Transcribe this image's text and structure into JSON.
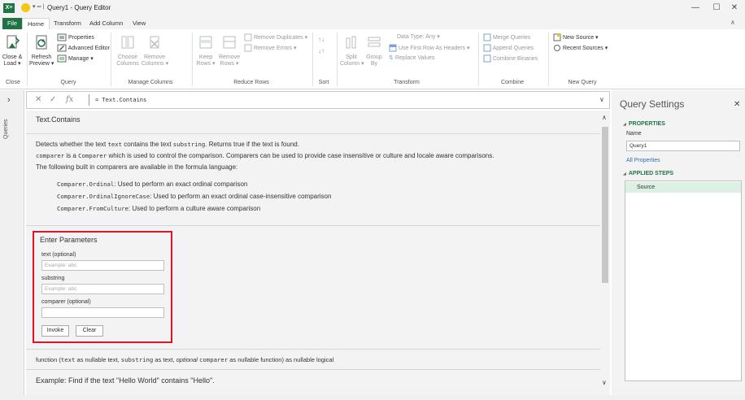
{
  "window": {
    "title": "Query1 - Query Editor",
    "app_icon": "X≡",
    "quick_access": "▾ ═ |",
    "minimize": "—",
    "maximize": "☐",
    "close": "✕",
    "ribbon_collapse": "∧"
  },
  "tabs": [
    "File",
    "Home",
    "Transform",
    "Add Column",
    "View"
  ],
  "ribbon": {
    "close_load": "Close &",
    "close_load2": "Load ▾",
    "refresh": "Refresh",
    "refresh2": "Preview ▾",
    "properties": "Properties",
    "advanced_editor": "Advanced Editor",
    "manage": "Manage ▾",
    "choose_columns": "Choose",
    "choose_columns2": "Columns",
    "remove_columns": "Remove",
    "remove_columns2": "Columns ▾",
    "keep_rows": "Keep",
    "keep_rows2": "Rows ▾",
    "remove_rows": "Remove",
    "remove_rows2": "Rows ▾",
    "remove_duplicates": "Remove Duplicates ▾",
    "remove_errors": "Remove Errors ▾",
    "split_column": "Split",
    "split_column2": "Column ▾",
    "group_by": "Group",
    "group_by2": "By",
    "data_type": "Data Type: Any ▾",
    "use_first_row": "Use First Row As Headers ▾",
    "replace_values": "Replace Values",
    "merge_queries": "Merge Queries",
    "append_queries": "Append Queries",
    "combine_binaries": "Combine Binaries",
    "new_source": "New Source ▾",
    "recent_sources": "Recent Sources ▾",
    "groups": {
      "close": "Close",
      "query": "Query",
      "manage_columns": "Manage Columns",
      "reduce_rows": "Reduce Rows",
      "sort": "Sort",
      "transform": "Transform",
      "combine": "Combine",
      "new_query": "New Query"
    }
  },
  "left_pane": {
    "toggle": "›",
    "label": "Queries"
  },
  "formula_bar": {
    "cancel": "✕",
    "commit": "✓",
    "fx": "fx",
    "formula": "= Text.Contains",
    "expand": "∨"
  },
  "function_info": {
    "name": "Text.Contains",
    "desc1_a": "Detects whether the text ",
    "desc1_b": "text",
    "desc1_c": " contains the text ",
    "desc1_d": "substring",
    "desc1_e": ". Returns true if the text is found.",
    "desc2_a": "comparer",
    "desc2_b": " is a ",
    "desc2_c": "Comparer",
    "desc2_d": " which is used to control the comparison. Comparers can be used to provide case insensitive or culture and locale aware comparisons.",
    "desc3": "The following built in comparers are available in the formula language:",
    "comparers": [
      {
        "code": "Comparer.Ordinal",
        "text": ": Used to perform an exact ordinal comparison"
      },
      {
        "code": "Comparer.OrdinalIgnoreCase",
        "text": ": Used to perform an exact ordinal case-insensitive comparison"
      },
      {
        "code": "Comparer.FromCulture",
        "text": ": Used to perform a culture aware comparison"
      }
    ]
  },
  "parameters": {
    "title": "Enter Parameters",
    "text_label": "text (optional)",
    "text_placeholder": "Example: abc",
    "substring_label": "substring",
    "substring_placeholder": "Example: abc",
    "comparer_label": "comparer (optional)",
    "invoke": "Invoke",
    "clear": "Clear"
  },
  "signature": {
    "a": "function (",
    "b": "text",
    "c": " as nullable text, ",
    "d": "substring",
    "e": " as text, ",
    "f": "optional",
    "g": " ",
    "h": "comparer",
    "i": " as nullable function) as nullable logical"
  },
  "example": "Example: Find if the text \"Hello World\" contains \"Hello\".",
  "scroll": {
    "up": "∧",
    "down": "∨"
  },
  "settings": {
    "title": "Query Settings",
    "close": "✕",
    "properties": "PROPERTIES",
    "name_label": "Name",
    "name_value": "Query1",
    "all_properties": "All Properties",
    "applied_steps": "APPLIED STEPS",
    "steps": [
      "Source"
    ]
  },
  "colors": {
    "accent": "#217346",
    "highlight_border": "#e81123",
    "step_selected": "#dcf0e4"
  }
}
